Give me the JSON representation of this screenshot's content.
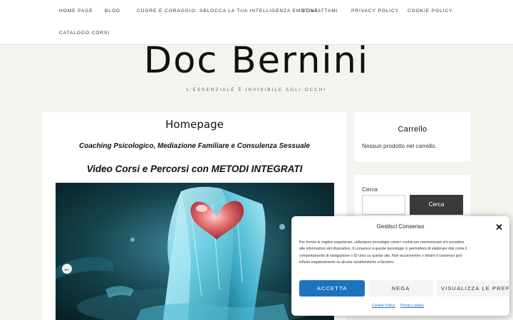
{
  "nav": {
    "items": [
      "HOME PAGE",
      "BLOG",
      "CUORE E CORAGGIO: SBLOCCA LA TUA INTELLIGENZA EMOTIVA",
      "CONTATTAMI",
      "PRIVACY POLICY",
      "COOKIE POLICY",
      "CATALOGO CORSI"
    ]
  },
  "header": {
    "title": "Doc Bernini",
    "tagline": "L'ESSENZIALE È INVISIBILE AGLI OCCHI"
  },
  "main": {
    "page_title": "Homepage",
    "subtitle": "Coaching Psicologico, Mediazione Familiare e Consulenza Sessuale",
    "video_title": "Video Corsi e Percorsi con METODI INTEGRATI",
    "slider_arrow": "left-arrow-icon"
  },
  "sidebar": {
    "cart": {
      "title": "Carrello",
      "empty_text": "Nessun prodotto nel carrello."
    },
    "search": {
      "label": "Cerca",
      "button": "Cerca"
    }
  },
  "consent": {
    "title": "Gestisci Consenso",
    "body": "Per fornire le migliori esperienze, utilizziamo tecnologie come i cookie per memorizzare e/o accedere alle informazioni del dispositivo. Il consenso a queste tecnologie ci permetterà di elaborare dati come il comportamento di navigazione o ID unici su questo sito. Non acconsentire o ritirare il consenso può influire negativamente su alcune caratteristiche e funzioni.",
    "accept": "ACCETTA",
    "deny": "NEGA",
    "prefs": "VISUALIZZA LE PREFERENZE",
    "link_cookie": "Cookie Policy",
    "link_privacy": "Privacy policy"
  },
  "colors": {
    "accent": "#1e73be",
    "page_bg": "#f4f3ee",
    "search_button": "#3a3a3a"
  }
}
